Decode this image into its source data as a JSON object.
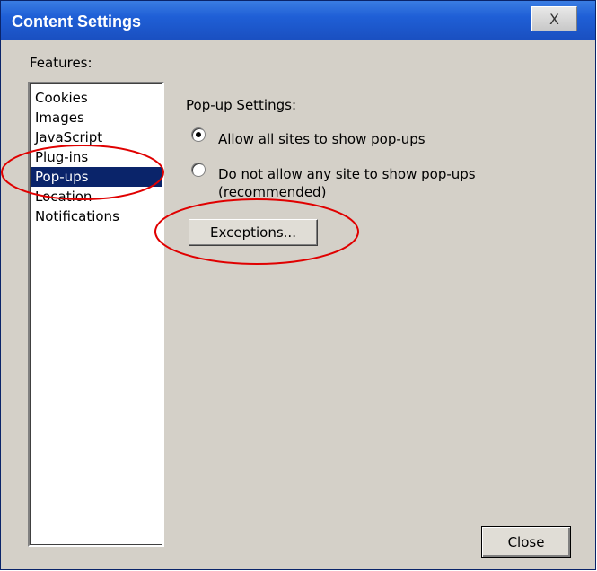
{
  "window": {
    "title": "Content Settings",
    "close_glyph": "X"
  },
  "features": {
    "label": "Features:",
    "items": [
      "Cookies",
      "Images",
      "JavaScript",
      "Plug-ins",
      "Pop-ups",
      "Location",
      "Notifications"
    ],
    "selected": "Pop-ups"
  },
  "popup": {
    "heading": "Pop-up Settings:",
    "options": [
      {
        "label_lines": [
          "Allow all sites to show pop-ups"
        ],
        "checked": true
      },
      {
        "label_lines": [
          "Do not allow any site to show pop-ups",
          "(recommended)"
        ],
        "checked": false
      }
    ],
    "exceptions_label": "Exceptions..."
  },
  "footer": {
    "close_label": "Close"
  },
  "colors": {
    "title_bar": "#1f5fd6",
    "selection": "#0a246a",
    "annotation": "#e00000",
    "dialog_bg": "#d4d0c8"
  }
}
